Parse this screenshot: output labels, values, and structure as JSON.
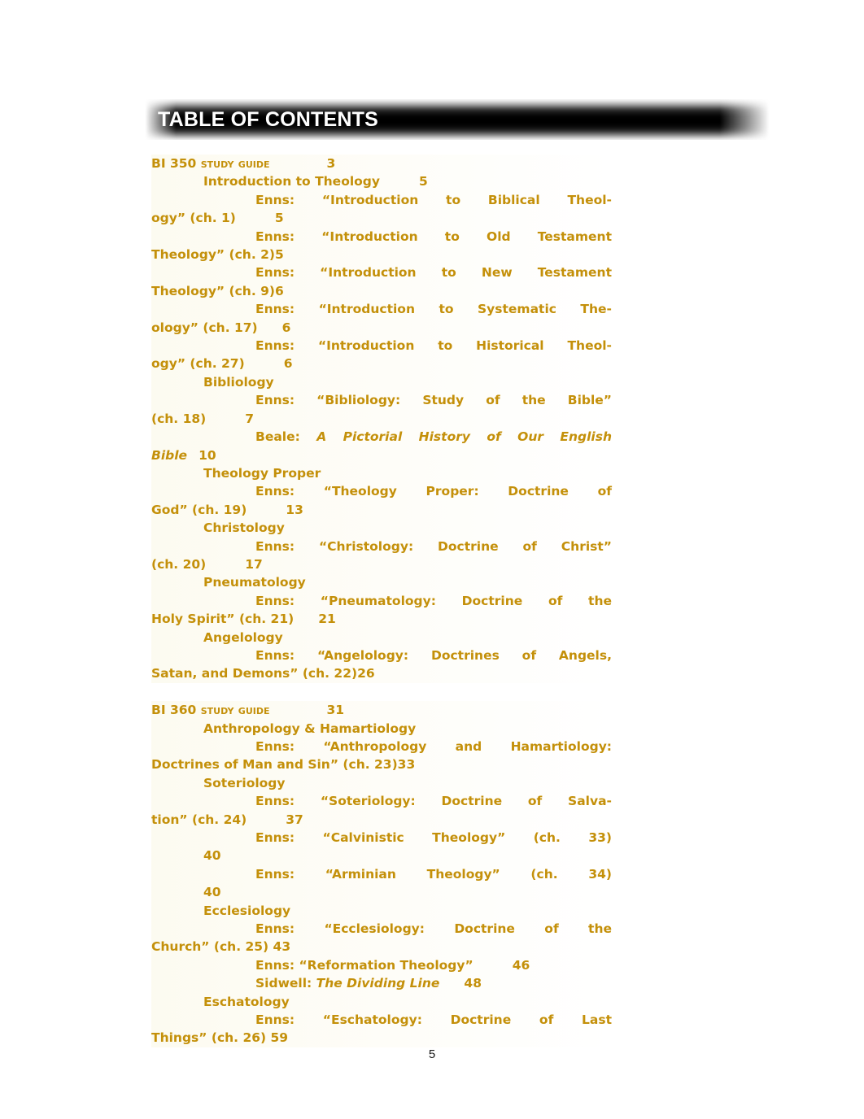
{
  "document": {
    "heading": "TABLE OF CONTENTS",
    "page_number": "5",
    "accent_color": "#c4900a",
    "heading_bar_color": "#000000",
    "heading_text_color": "#ffffff"
  },
  "toc": {
    "sections": [
      {
        "title_prefix": "B",
        "title_rest": "I 350 ",
        "title_caps": "Study Guide",
        "page": "3",
        "entries": [
          {
            "level": 1,
            "text": "Introduction to Theology",
            "page": "5"
          },
          {
            "level": 2,
            "text": "Enns: “Introduction to Biblical Theology” (ch. 1)",
            "page": "5"
          },
          {
            "level": 2,
            "text": "Enns: “Introduction to Old Testament Theology” (ch. 2)",
            "page": "5"
          },
          {
            "level": 2,
            "text": "Enns: “Introduction to New Testament Theology” (ch. 9)",
            "page": "6"
          },
          {
            "level": 2,
            "text": "Enns: “Introduction to Systematic Theology” (ch. 17)",
            "page": "6"
          },
          {
            "level": 2,
            "text": "Enns: “Introduction to Historical Theology” (ch. 27)",
            "page": "6"
          },
          {
            "level": 1,
            "text": "Bibliology",
            "page": ""
          },
          {
            "level": 2,
            "text": "Enns: “Bibliology: Study of the Bible” (ch. 18)",
            "page": "7"
          },
          {
            "level": 2,
            "text_plain": "Beale: ",
            "text_italic": "A Pictorial History of Our English Bible",
            "page": "10"
          },
          {
            "level": 1,
            "text": "Theology Proper",
            "page": ""
          },
          {
            "level": 2,
            "text": "Enns: “Theology Proper: Doctrine of God” (ch. 19)",
            "page": "13"
          },
          {
            "level": 1,
            "text": "Christology",
            "page": ""
          },
          {
            "level": 2,
            "text": "Enns: “Christology: Doctrine of Christ” (ch. 20)",
            "page": "17"
          },
          {
            "level": 1,
            "text": "Pneumatology",
            "page": ""
          },
          {
            "level": 2,
            "text": "Enns: “Pneumatology: Doctrine of the Holy Spirit” (ch. 21)",
            "page": "21"
          },
          {
            "level": 1,
            "text": "Angelology",
            "page": ""
          },
          {
            "level": 2,
            "text": "Enns: “Angelology: Doctrines of Angels, Satan, and Demons” (ch. 22)",
            "page": "26"
          }
        ]
      },
      {
        "title_prefix": "B",
        "title_rest": "I 360 ",
        "title_caps": "Study Guide",
        "page": "31",
        "entries": [
          {
            "level": 1,
            "text": "Anthropology & Hamartiology",
            "page": ""
          },
          {
            "level": 2,
            "text": "Enns: “Anthropology and Hamartiology: Doctrines of Man and Sin” (ch. 23)",
            "page": "33"
          },
          {
            "level": 1,
            "text": "Soteriology",
            "page": ""
          },
          {
            "level": 2,
            "text": "Enns: “Soteriology: Doctrine of Salvation” (ch. 24)",
            "page": "37"
          },
          {
            "level": 2,
            "text": "Enns: “Calvinistic Theology” (ch. 33)",
            "page": "40"
          },
          {
            "level": 2,
            "text": "Enns: “Arminian Theology” (ch. 34)",
            "page": "40"
          },
          {
            "level": 1,
            "text": "Ecclesiology",
            "page": ""
          },
          {
            "level": 2,
            "text": "Enns: “Ecclesiology: Doctrine of the Church” (ch. 25)",
            "page": "43"
          },
          {
            "level": 2,
            "text": "Enns: “Reformation Theology”",
            "page": "46"
          },
          {
            "level": 2,
            "text_plain": "Sidwell: ",
            "text_italic": "The Dividing Line",
            "page": "48"
          },
          {
            "level": 1,
            "text": "Eschatology",
            "page": ""
          },
          {
            "level": 2,
            "text": "Enns: “Eschatology: Doctrine of Last Things” (ch. 26)",
            "page": "59"
          }
        ]
      }
    ]
  },
  "lines": {
    "l1": {
      "a": "B",
      "b": "I 350 ",
      "c": "Study Guide",
      "d": "3"
    },
    "l2": {
      "a": "Introduction to Theology",
      "b": "5"
    },
    "l3": {
      "a": "Enns: “Introduction to Biblical Theol-",
      "b": "ogy” (ch. 1)",
      "c": "5"
    },
    "l4": {
      "a": "Enns: “Introduction to Old Testament",
      "b": "Theology” (ch. 2)5"
    },
    "l5": {
      "a": "Enns: “Introduction to New Testament",
      "b": "Theology” (ch. 9)6"
    },
    "l6": {
      "a": "Enns: “Introduction to Systematic The-",
      "b": "ology” (ch. 17)",
      "c": "6"
    },
    "l7": {
      "a": "Enns: “Introduction to Historical Theol-",
      "b": "ogy” (ch. 27)",
      "c": "6"
    },
    "l8": {
      "a": "Bibliology"
    },
    "l9": {
      "a": "Enns: “Bibliology: Study of the Bible”",
      "b": "(ch. 18)",
      "c": "7"
    },
    "l10": {
      "a": "Beale: ",
      "b": "A Pictorial History of Our English",
      "c": "Bible",
      "d": "10"
    },
    "l11": {
      "a": "Theology Proper"
    },
    "l12": {
      "a": "Enns: “Theology Proper: Doctrine of",
      "b": "God” (ch. 19)",
      "c": "13"
    },
    "l13": {
      "a": "Christology"
    },
    "l14": {
      "a": "Enns: “Christology: Doctrine of Christ”",
      "b": "(ch. 20)",
      "c": "17"
    },
    "l15": {
      "a": "Pneumatology"
    },
    "l16": {
      "a": "Enns: “Pneumatology: Doctrine of the",
      "b": "Holy Spirit” (ch. 21)",
      "c": "21"
    },
    "l17": {
      "a": "Angelology"
    },
    "l18": {
      "a": "Enns: “Angelology: Doctrines of Angels,",
      "b": "Satan, and Demons” (ch. 22)26"
    },
    "l19": {
      "a": "B",
      "b": "I 360 ",
      "c": "Study Guide",
      "d": "31"
    },
    "l20": {
      "a": "Anthropology & Hamartiology"
    },
    "l21": {
      "a": "Enns: “Anthropology and Hamartiology:",
      "b": "Doctrines of Man and Sin” (ch. 23)33"
    },
    "l22": {
      "a": "Soteriology"
    },
    "l23": {
      "a": "Enns: “Soteriology: Doctrine of Salva-",
      "b": "tion” (ch. 24)",
      "c": "37"
    },
    "l24": {
      "a": "Enns: “Calvinistic Theology” (ch. 33)",
      "b": "40"
    },
    "l25": {
      "a": "Enns: “Arminian Theology” (ch. 34)",
      "b": "40"
    },
    "l26": {
      "a": "Ecclesiology"
    },
    "l27": {
      "a": "Enns: “Ecclesiology: Doctrine of the",
      "b": "Church” (ch. 25) 43"
    },
    "l28": {
      "a": "Enns: “Reformation Theology”",
      "b": "46"
    },
    "l29": {
      "a": "Sidwell: ",
      "b": "The Dividing Line",
      "c": "48"
    },
    "l30": {
      "a": "Eschatology"
    },
    "l31": {
      "a": "Enns: “Eschatology: Doctrine of Last",
      "b": "Things” (ch. 26) 59"
    }
  }
}
